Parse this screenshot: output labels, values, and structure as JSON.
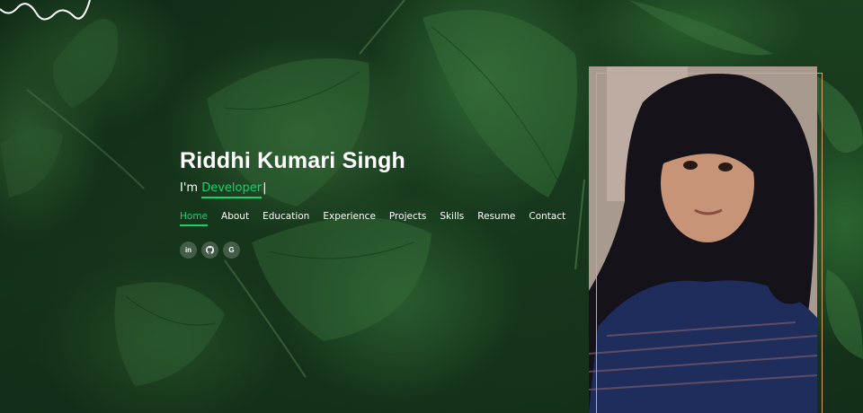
{
  "profile": {
    "name": "Riddhi Kumari Singh",
    "role_prefix": "I'm",
    "role_typed": "Developer",
    "cursor": "|"
  },
  "nav": {
    "items": [
      "Home",
      "About",
      "Education",
      "Experience",
      "Projects",
      "Skills",
      "Resume",
      "Contact"
    ],
    "active": "Home"
  },
  "social": {
    "linkedin": "in",
    "github_icon": "github-icon",
    "google": "G"
  },
  "colors": {
    "accent": "#18d26e",
    "frame": "#e2a06a",
    "leaf": "#2c5e30"
  }
}
